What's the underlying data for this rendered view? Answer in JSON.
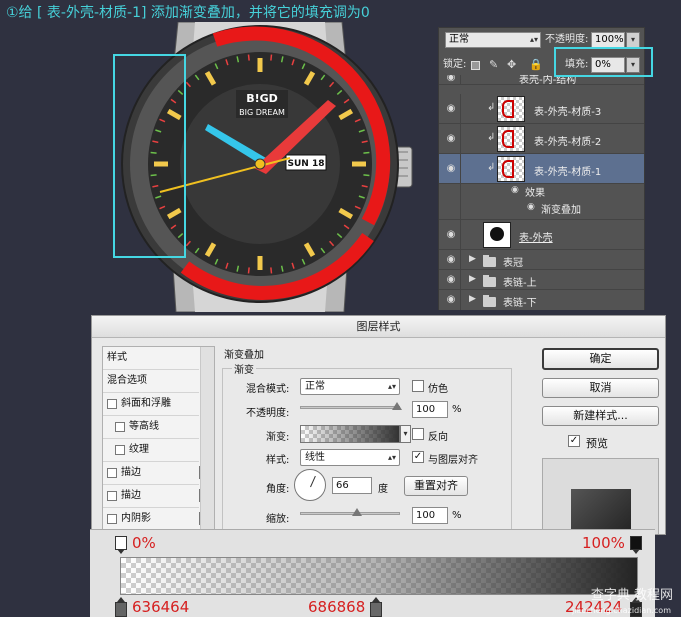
{
  "instruction": "①给 [ 表-外壳-材质-1] 添加渐变叠加，并将它的填充调为0",
  "watch": {
    "brand": "B!GD",
    "brand_sub": "BIG DREAM",
    "date": "SUN 18"
  },
  "layers_panel": {
    "blend_mode": "正常",
    "opacity_label": "不透明度:",
    "opacity_value": "100%",
    "lock_label": "锁定:",
    "fill_label": "填充:",
    "fill_value": "0%",
    "layers": [
      {
        "name": "表壳-内-结构"
      },
      {
        "name": "表-外壳-材质-3"
      },
      {
        "name": "表-外壳-材质-2"
      },
      {
        "name": "表-外壳-材质-1"
      },
      {
        "name": "效果"
      },
      {
        "name": "渐变叠加"
      },
      {
        "name": "表-外壳"
      },
      {
        "name": "表冠"
      },
      {
        "name": "表链-上"
      },
      {
        "name": "表链-下"
      }
    ]
  },
  "dialog": {
    "title": "图层样式",
    "styles": [
      {
        "label": "样式"
      },
      {
        "label": "混合选项"
      },
      {
        "label": "斜面和浮雕"
      },
      {
        "label": "等高线"
      },
      {
        "label": "纹理"
      },
      {
        "label": "描边"
      },
      {
        "label": "描边"
      },
      {
        "label": "内阴影"
      }
    ],
    "section_title": "渐变叠加",
    "group_title": "渐变",
    "blend_mode_label": "混合模式:",
    "blend_mode_value": "正常",
    "dither_label": "仿色",
    "opacity_label": "不透明度:",
    "opacity_value": "100",
    "percent": "%",
    "gradient_label": "渐变:",
    "reverse_label": "反向",
    "style_label": "样式:",
    "style_value": "线性",
    "align_label": "与图层对齐",
    "angle_label": "角度:",
    "angle_value": "66",
    "angle_unit": "度",
    "reset_align_button": "重置对齐",
    "scale_label": "缩放:",
    "scale_value": "100",
    "ok_button": "确定",
    "cancel_button": "取消",
    "new_style_button": "新建样式...",
    "preview_label": "预览"
  },
  "gradient_editor": {
    "opacity_left": "0%",
    "opacity_right": "100%",
    "stop_left_color": "636464",
    "stop_mid_color": "686868",
    "stop_right_color": "242424"
  },
  "watermark": {
    "text": "查字典 教程网",
    "url": "jiaocheng.chazidian.com"
  },
  "colors": {
    "accent": "#45d7e3",
    "red_stop_text": "#d62020",
    "selected_layer": "#5d7090"
  }
}
